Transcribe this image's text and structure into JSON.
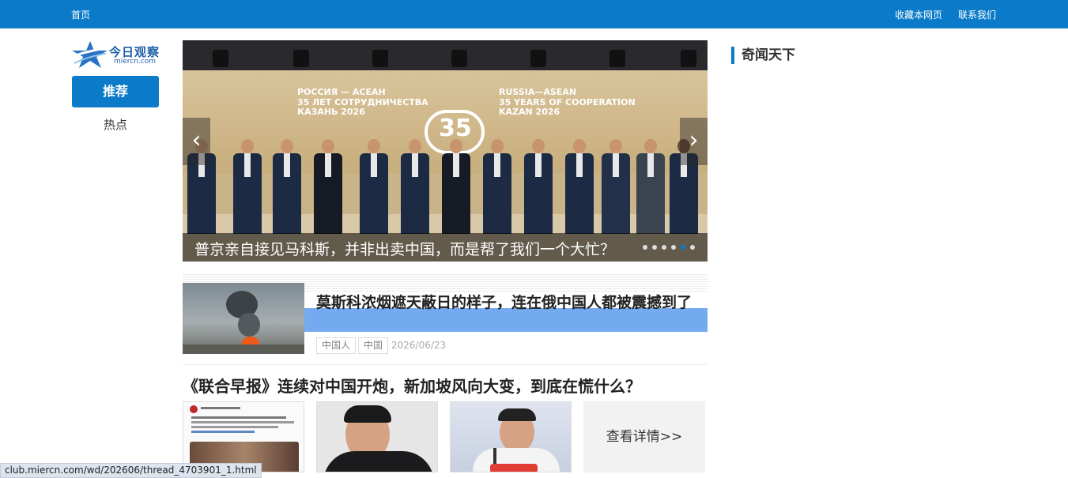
{
  "topbar": {
    "home": "首页",
    "favorite": "收藏本网页",
    "contact": "联系我们"
  },
  "logo": {
    "name": "今日观察",
    "domain": "miercn.com"
  },
  "nav": {
    "tabs": [
      {
        "label": "推荐",
        "active": true
      },
      {
        "label": "热点",
        "active": false
      }
    ]
  },
  "carousel": {
    "caption": "普京亲自接见马科斯，并非出卖中国，而是帮了我们一个大忙？",
    "backdrop_left": "РОССИЯ — АСЕАН\n35 ЛЕТ СОТРУДНИЧЕСТВА\nКАЗАНЬ 2026",
    "backdrop_right": "RUSSIA—ASEAN\n35 YEARS OF COOPERATION\nKAZAN 2026",
    "backdrop_number": "35",
    "slide_count": 6,
    "active_slide": 5
  },
  "articles": [
    {
      "title": "莫斯科浓烟遮天蔽日的样子，连在俄中国人都被震撼到了",
      "tags": [
        "中国人",
        "中国"
      ],
      "date": "2026/06/23"
    },
    {
      "title": "《联合早报》连续对中国开炮，新加坡风向大变，到底在慌什么？",
      "more_label": "查看详情>>"
    }
  ],
  "sidebar": {
    "title": "奇闻天下"
  },
  "status_bar": {
    "url": "club.miercn.com/wd/202606/thread_4703901_1.html"
  },
  "colors": {
    "brand_blue": "#0b7bc9",
    "highlight": "#74aaf0"
  }
}
